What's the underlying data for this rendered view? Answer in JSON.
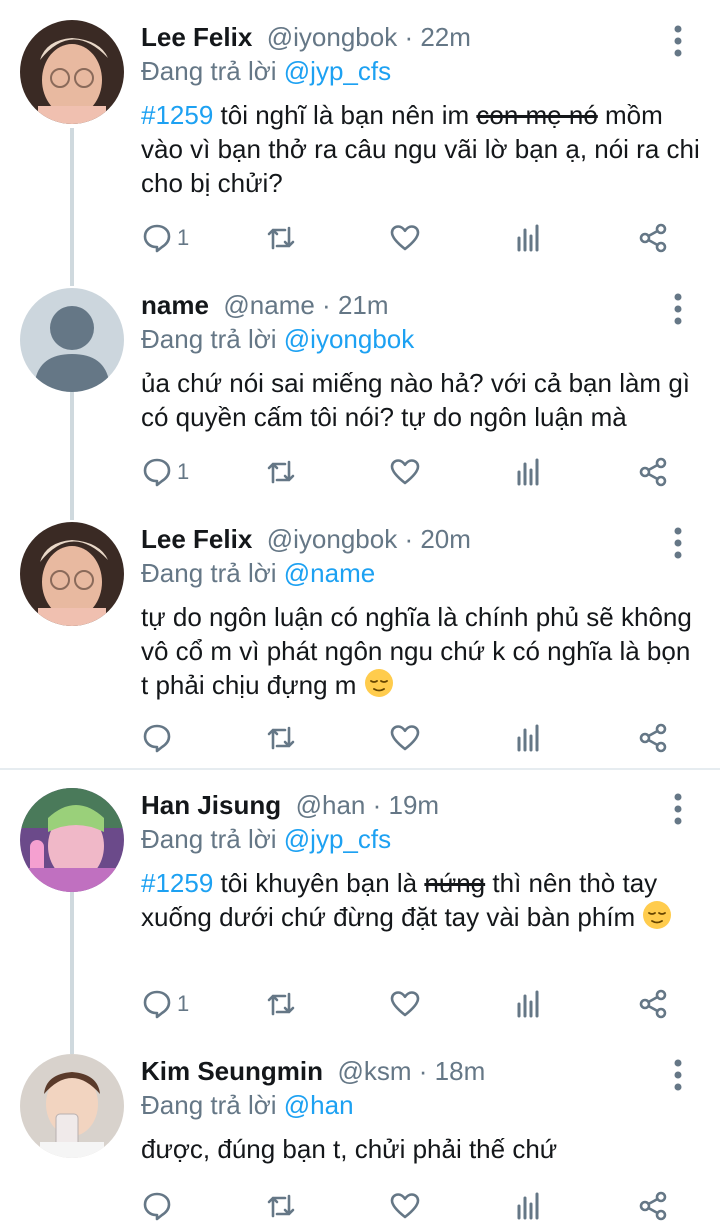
{
  "tweets": [
    {
      "name": "Lee Felix",
      "handle": "@iyongbok",
      "sep": " · ",
      "time": "22m",
      "reply_prefix": "Đang trả lời ",
      "reply_to": "@jyp_cfs",
      "hashtag": "#1259",
      "text_a": " tôi nghĩ là bạn nên im ",
      "struck": "con mẹ nó",
      "text_b": " mồm vào vì bạn thở ra câu ngu vãi lờ bạn ạ, nói ra chi cho bị chửi?",
      "reply_count": "1",
      "avatar": "felix"
    },
    {
      "name": "name",
      "handle": "@name",
      "sep": " · ",
      "time": "21m",
      "reply_prefix": "Đang trả lời ",
      "reply_to": "@iyongbok",
      "text_a": "ủa chứ nói sai miếng nào hả? với cả bạn làm gì có quyền cấm tôi nói? tự do ngôn luận mà",
      "reply_count": "1",
      "avatar": "default"
    },
    {
      "name": "Lee Felix",
      "handle": "@iyongbok",
      "sep": " · ",
      "time": "20m",
      "reply_prefix": "Đang trả lời ",
      "reply_to": "@name",
      "text_a": "tự do ngôn luận có nghĩa là chính phủ sẽ không vô cổ m vì phát ngôn ngu chứ k có nghĩa là bọn t phải chịu đựng m ",
      "reply_count": "",
      "avatar": "felix"
    },
    {
      "name": "Han Jisung",
      "handle": "@han",
      "sep": " · ",
      "time": "19m",
      "reply_prefix": "Đang trả lời ",
      "reply_to": "@jyp_cfs",
      "hashtag": "#1259",
      "text_a": " tôi khuyên bạn là ",
      "struck": "nứng",
      "text_b": " thì nên thò tay xuống dưới chứ đừng đặt tay vài bàn phím ",
      "reply_count": "1",
      "avatar": "han"
    },
    {
      "name": "Kim Seungmin",
      "handle": "@ksm",
      "sep": " · ",
      "time": "18m",
      "reply_prefix": "Đang trả lời ",
      "reply_to": "@han",
      "text_a": "được, đúng bạn t, chửi phải thế chứ",
      "reply_count": "",
      "avatar": "seungmin"
    }
  ],
  "icons": {
    "reply": "reply-icon",
    "retweet": "retweet-icon",
    "like": "heart-icon",
    "stats": "analytics-icon",
    "share": "share-icon",
    "more": "more-vertical-icon",
    "emoji": "relieved-face-icon"
  },
  "colors": {
    "accent": "#1da1f2",
    "muted": "#657786",
    "text": "#14171a",
    "thread_line": "#cfd9de"
  }
}
